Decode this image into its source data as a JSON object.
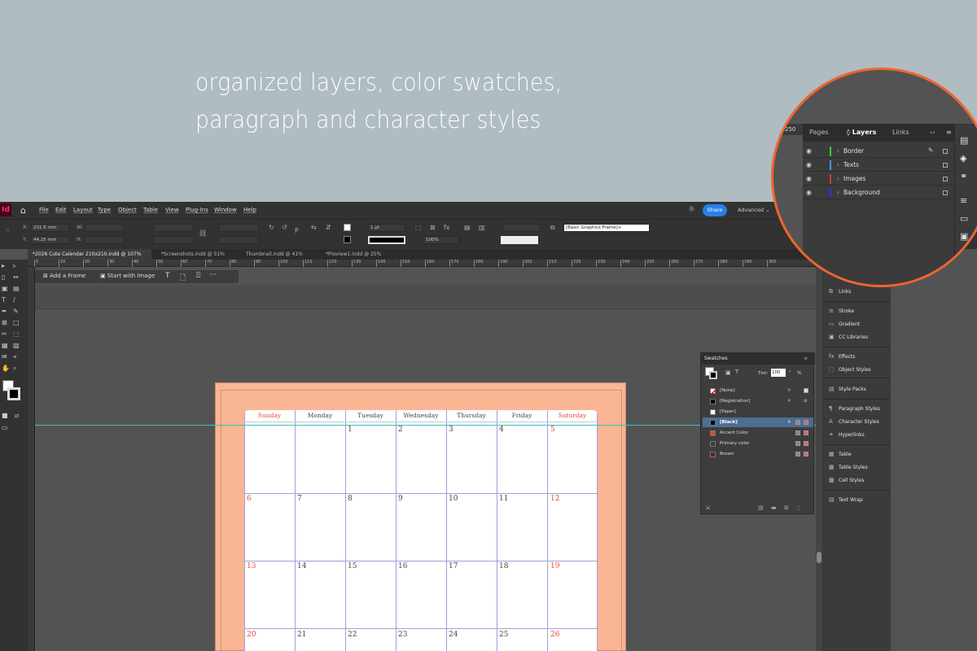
{
  "caption": {
    "line1": "organized layers, color swatches,",
    "line2": "paragraph and character styles"
  },
  "app": {
    "logo": "Id",
    "menu": [
      "File",
      "Edit",
      "Layout",
      "Type",
      "Object",
      "Table",
      "View",
      "Plug-Ins",
      "Window",
      "Help"
    ],
    "share": "Share",
    "workspace": "Advanced",
    "control": {
      "x_label": "X:",
      "x_value": "231.5 mm",
      "y_label": "Y:",
      "y_value": "44.25 mm",
      "w_label": "W:",
      "h_label": "H:",
      "stroke_weight": "1 pt",
      "opacity": "100%",
      "object_style": "[Basic Graphics Frame]+"
    },
    "tabs": [
      "*2026 Cute Calendar 210x210.indd @ 107%",
      "*Screenshots.indd @ 51%",
      "Thumbnail.indd @ 41%",
      "*Preview1.indd @ 25%"
    ],
    "ruler_ticks": [
      "0",
      "10",
      "20",
      "30",
      "40",
      "50",
      "60",
      "70",
      "80",
      "90",
      "100",
      "110",
      "120",
      "130",
      "140",
      "150",
      "160",
      "170",
      "180",
      "190",
      "200",
      "210",
      "220",
      "230",
      "240",
      "250",
      "260",
      "270",
      "280",
      "290",
      "300"
    ],
    "contextual": {
      "add_frame": "Add a Frame",
      "start_image": "Start with Image"
    }
  },
  "calendar": {
    "days": [
      "Sunday",
      "Monday",
      "Tuesday",
      "Wednesday",
      "Thursday",
      "Friday",
      "Saturday"
    ],
    "rows": [
      [
        "",
        "",
        "1",
        "2",
        "3",
        "4",
        "5"
      ],
      [
        "6",
        "7",
        "8",
        "9",
        "10",
        "11",
        "12"
      ],
      [
        "13",
        "14",
        "15",
        "16",
        "17",
        "18",
        "19"
      ],
      [
        "20",
        "21",
        "22",
        "23",
        "24",
        "25",
        "26"
      ]
    ],
    "weekend_color": "#e04a2f",
    "page_color": "#f9b695"
  },
  "swatches": {
    "title": "Swatches",
    "tint_label": "Tint:",
    "tint_value": "100",
    "tint_unit": "%",
    "items": [
      {
        "name": "[None]",
        "color": "none"
      },
      {
        "name": "[Registration]",
        "color": "#000000"
      },
      {
        "name": "[Paper]",
        "color": "#ffffff"
      },
      {
        "name": "[Black]",
        "color": "#000000",
        "selected": true
      },
      {
        "name": "Accent Color",
        "color": "#e0472d"
      },
      {
        "name": "Primary color",
        "color": "#3a3a3a"
      },
      {
        "name": "Brown",
        "color": "#6e1e16"
      }
    ]
  },
  "right_panel": {
    "items": [
      "Links",
      "Stroke",
      "Gradient",
      "CC Libraries",
      "Effects",
      "Object Styles",
      "Style Packs",
      "Paragraph Styles",
      "Character Styles",
      "Hyperlinks",
      "Table",
      "Table Styles",
      "Cell Styles",
      "Text Wrap"
    ]
  },
  "layers_zoom": {
    "tabs": [
      "Pages",
      "Layers",
      "Links"
    ],
    "ruler_value": "250",
    "layers": [
      {
        "name": "Border",
        "color": "#3ec63e"
      },
      {
        "name": "Texts",
        "color": "#4f8fe6"
      },
      {
        "name": "Images",
        "color": "#d23a3a"
      },
      {
        "name": "Background",
        "color": "#2a36e6"
      }
    ],
    "highlight_color": "#ef6530"
  }
}
